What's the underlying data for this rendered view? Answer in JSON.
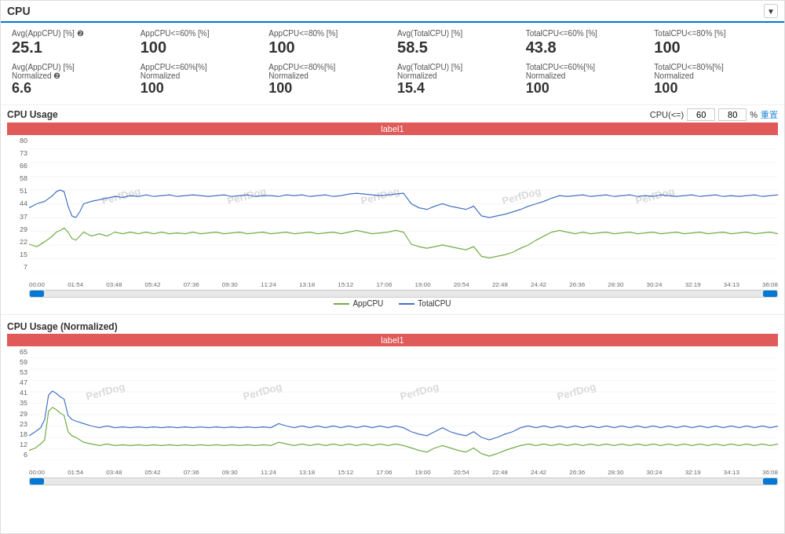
{
  "header": {
    "title": "CPU",
    "icon": "▼"
  },
  "metrics": {
    "row1": [
      {
        "label": "Avg(AppCPU) [%] ❷",
        "value": "25.1"
      },
      {
        "label": "AppCPU<=60% [%]",
        "value": "100"
      },
      {
        "label": "AppCPU<=80% [%]",
        "value": "100"
      },
      {
        "label": "Avg(TotalCPU) [%]",
        "value": "58.5"
      },
      {
        "label": "TotalCPU<=60% [%]",
        "value": "43.8"
      },
      {
        "label": "TotalCPU<=80% [%]",
        "value": "100"
      }
    ],
    "row2": [
      {
        "label": "Avg(AppCPU) [%] Normalized ❷",
        "value": "6.6"
      },
      {
        "label": "AppCPU<=60%[%] Normalized",
        "value": "100"
      },
      {
        "label": "AppCPU<=80%[%] Normalized",
        "value": "100"
      },
      {
        "label": "Avg(TotalCPU) [%] Normalized",
        "value": "15.4"
      },
      {
        "label": "TotalCPU<=60%[%] Normalized",
        "value": "100"
      },
      {
        "label": "TotalCPU<=80%[%] Normalized",
        "value": "100"
      }
    ]
  },
  "chart1": {
    "title": "CPU Usage",
    "label_bar": "label1",
    "cpu_controls": "CPU(<=)",
    "val60": "60",
    "val80": "80",
    "unit": "%",
    "reset": "重置",
    "legend": {
      "appcpu": "AppCPU",
      "totalcpu": "TotalCPU"
    },
    "y_labels": [
      "80",
      "73",
      "66",
      "58",
      "51",
      "44",
      "37",
      "29",
      "22",
      "15",
      "7"
    ],
    "x_labels": [
      "00:00",
      "01:54",
      "03:48",
      "05:42",
      "07:36",
      "09:30",
      "11:24",
      "13:18",
      "15:12",
      "17:06",
      "19:00",
      "20:54",
      "22:48",
      "24:42",
      "26:36",
      "28:30",
      "30:24",
      "32:19",
      "34:13",
      "36:08"
    ]
  },
  "chart2": {
    "title": "CPU Usage (Normalized)",
    "label_bar": "label1",
    "y_labels": [
      "65",
      "59",
      "53",
      "47",
      "41",
      "35",
      "29",
      "23",
      "18",
      "12",
      "6"
    ],
    "x_labels": [
      "00:00",
      "01:54",
      "03:48",
      "05:42",
      "07:36",
      "09:30",
      "11:24",
      "13:18",
      "15:12",
      "17:06",
      "19:00",
      "20:54",
      "22:48",
      "24:42",
      "26:36",
      "28:30",
      "30:24",
      "32:19",
      "34:13",
      "36:08"
    ]
  },
  "watermarks": [
    "PerfDog",
    "PerfDog",
    "PerfDog",
    "PerfDog"
  ]
}
